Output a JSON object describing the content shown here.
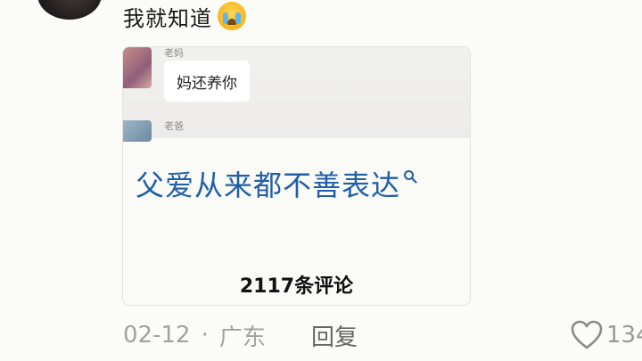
{
  "comment": {
    "text": "我就知道",
    "emoji": "loudly-crying-face"
  },
  "card": {
    "chat": {
      "mom_name": "老妈",
      "mom_message": "妈还养你",
      "dad_name": "老爸"
    },
    "search_text": "父爱从来都不善表达",
    "comment_count": "2117条评论"
  },
  "meta": {
    "date": "02-12",
    "separator": "·",
    "location": "广东",
    "reply_label": "回复",
    "like_count": "134"
  },
  "colors": {
    "link_blue": "#1f5fa6",
    "muted_gray": "#a2a2a2"
  }
}
